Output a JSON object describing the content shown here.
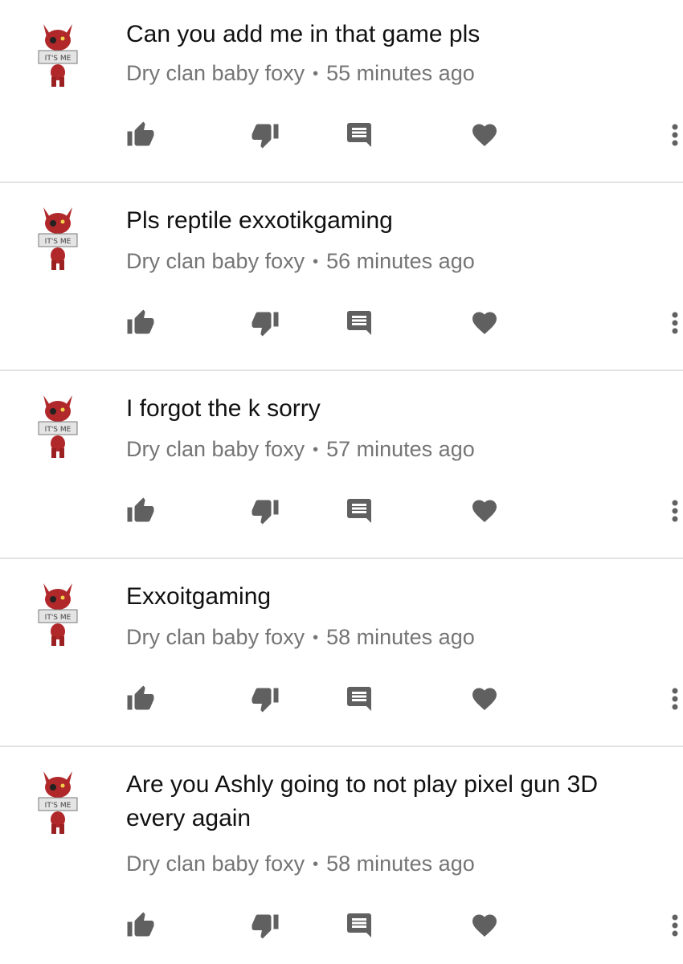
{
  "colors": {
    "icon": "#606060",
    "meta": "#757575",
    "text": "#111111",
    "divider": "#e2e2e2",
    "avatar_red": "#b0282a"
  },
  "icons": {
    "like": "thumbs-up-icon",
    "dislike": "thumbs-down-icon",
    "reply": "reply-icon",
    "heart": "heart-icon",
    "more": "more-vertical-icon"
  },
  "comments": [
    {
      "text": "Can you add me in that game pls",
      "author": "Dry clan baby foxy",
      "separator": "•",
      "time": "55 minutes ago",
      "avatar_sign": "IT'S ME"
    },
    {
      "text": "Pls reptile exxotikgaming",
      "author": "Dry clan baby foxy",
      "separator": "•",
      "time": "56 minutes ago",
      "avatar_sign": "IT'S ME"
    },
    {
      "text": "I forgot the k sorry",
      "author": "Dry clan baby foxy",
      "separator": "•",
      "time": "57 minutes ago",
      "avatar_sign": "IT'S ME"
    },
    {
      "text": "Exxoitgaming",
      "author": "Dry clan baby foxy",
      "separator": "•",
      "time": "58 minutes ago",
      "avatar_sign": "IT'S ME"
    },
    {
      "text": "Are you Ashly going to not play pixel gun 3D every again",
      "author": "Dry clan baby foxy",
      "separator": "•",
      "time": "58 minutes ago",
      "avatar_sign": "IT'S ME"
    }
  ]
}
